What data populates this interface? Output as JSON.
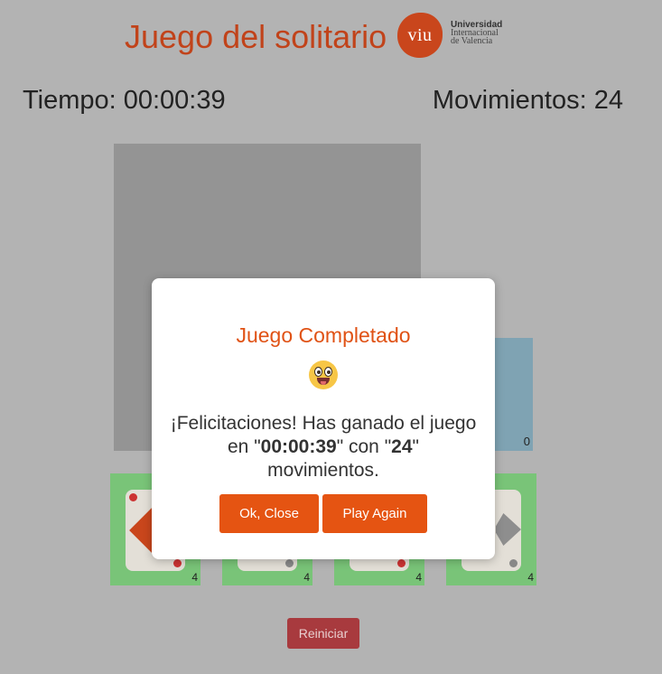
{
  "header": {
    "title": "Juego del solitario",
    "logo": {
      "mark": "viu",
      "line1": "Universidad",
      "line2": "Internacional",
      "line3": "de Valencia"
    }
  },
  "stats": {
    "time_label": "Tiempo: 00:00:39",
    "moves_label": "Movimientos: 24"
  },
  "board": {
    "discard_count": "0",
    "piles": [
      {
        "count": "4"
      },
      {
        "count": "4"
      },
      {
        "count": "4"
      },
      {
        "count": "4"
      }
    ]
  },
  "reset_label": "Reiniciar",
  "modal": {
    "title": "Juego Completado",
    "message_pre": "¡Felicitaciones! Has ganado el juego en \"",
    "time": "00:00:39",
    "message_mid": "\" con \"",
    "moves": "24",
    "message_post": "\" movimientos.",
    "ok_label": "Ok, Close",
    "again_label": "Play Again"
  },
  "colors": {
    "accent": "#e55412",
    "title": "#c1431a",
    "pile_bg": "#79c478",
    "reset_bg": "#a83a3e"
  }
}
